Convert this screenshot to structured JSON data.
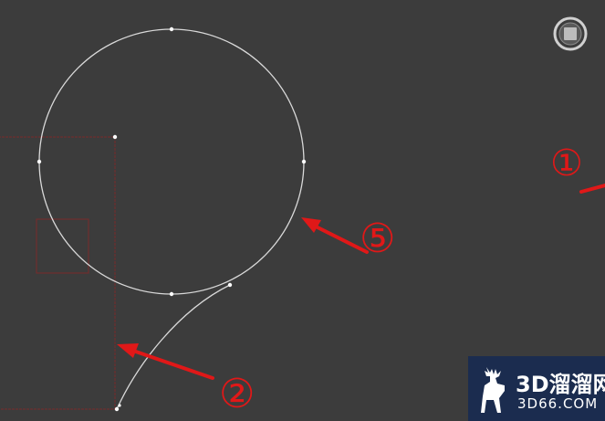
{
  "viewport": {
    "background_color": "#3c3c3c",
    "spline_color": "#d9d9d9",
    "vertex_color": "#ffffff",
    "selection_box_color": "#7a2a2a",
    "annotation_color": "#e01818"
  },
  "nav_control": {
    "icon": "viewcube-reset-icon"
  },
  "annotations": {
    "label_1": "①",
    "label_2": "②",
    "label_5": "⑤"
  },
  "watermark": {
    "icon": "deer-logo-icon",
    "line1": "3D溜溜网",
    "line2": "3D66.COM"
  }
}
